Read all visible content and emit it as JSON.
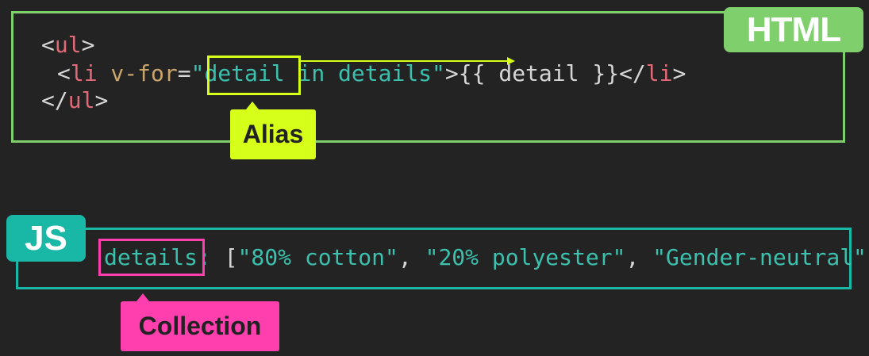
{
  "html_section": {
    "badge": "HTML",
    "line1": {
      "open": "<",
      "tag": "ul",
      "close": ">"
    },
    "line2": {
      "open": "<",
      "tag": "li",
      "attr": " v-for",
      "eq": "=",
      "quote_open": "\"",
      "alias": "detail",
      "rest": " in details",
      "quote_close": "\"",
      "gt": ">",
      "mustache": "{{ detail }}",
      "close_open": "</",
      "close_tag": "li",
      "close_gt": ">"
    },
    "line3": {
      "open": "</",
      "tag": "ul",
      "close": ">"
    }
  },
  "js_section": {
    "badge": "JS",
    "key": "details:",
    "open_bracket": " [",
    "items": [
      "\"80% cotton\"",
      "\"20% polyester\"",
      "\"Gender-neutral\""
    ],
    "separator": ", ",
    "close_bracket": "]"
  },
  "callouts": {
    "alias": "Alias",
    "collection": "Collection"
  },
  "colors": {
    "html_border": "#7fd06c",
    "js_border": "#19b7a6",
    "alias_highlight": "#d6ff1a",
    "collection_highlight": "#ff3fae"
  }
}
